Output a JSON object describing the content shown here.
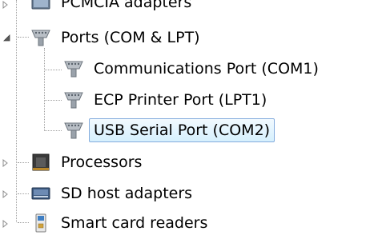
{
  "tree": {
    "items": [
      {
        "label": "PCMCIA adapters",
        "icon": "pcmcia-adapter-icon",
        "expanded": false
      },
      {
        "label": "Ports (COM & LPT)",
        "icon": "port-connector-icon",
        "expanded": true,
        "children": [
          {
            "label": "Communications Port (COM1)",
            "icon": "port-connector-icon"
          },
          {
            "label": "ECP Printer Port (LPT1)",
            "icon": "port-connector-icon"
          },
          {
            "label": "USB Serial Port (COM2)",
            "icon": "port-connector-icon",
            "selected": true
          }
        ]
      },
      {
        "label": "Processors",
        "icon": "processor-chip-icon",
        "expanded": false
      },
      {
        "label": "SD host adapters",
        "icon": "sd-host-adapter-icon",
        "expanded": false
      },
      {
        "label": "Smart card readers",
        "icon": "smart-card-reader-icon",
        "expanded": false
      }
    ]
  },
  "colors": {
    "selection_fill": "#d6f0fd",
    "selection_border": "#84acdd",
    "tree_line": "#a0a0a0",
    "expander_arrow": "#8c8c8c"
  }
}
